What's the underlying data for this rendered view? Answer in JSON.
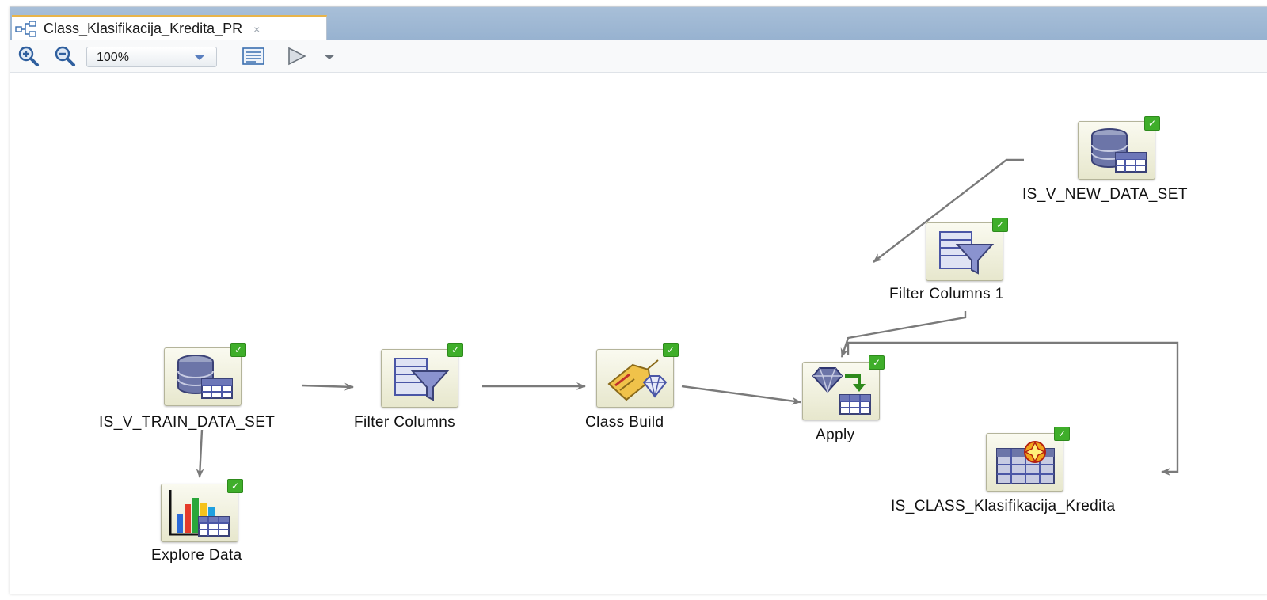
{
  "tab": {
    "title": "Class_Klasifikacija_Kredita_PR",
    "close": "×"
  },
  "toolbar": {
    "zoom_value": "100%"
  },
  "nodes": {
    "train": {
      "label": "IS_V_TRAIN_DATA_SET",
      "check": "✓"
    },
    "filter": {
      "label": "Filter Columns",
      "check": "✓"
    },
    "build": {
      "label": "Class Build",
      "check": "✓"
    },
    "apply": {
      "label": "Apply",
      "check": "✓"
    },
    "newdata": {
      "label": "IS_V_NEW_DATA_SET",
      "check": "✓"
    },
    "filter1": {
      "label": "Filter Columns 1",
      "check": "✓"
    },
    "classout": {
      "label": "IS_CLASS_Klasifikacija_Kredita",
      "check": "✓"
    },
    "explore": {
      "label": "Explore Data",
      "check": "✓"
    }
  },
  "colors": {
    "tab_strip": "#97b2d0",
    "node_fill": "#efefd9",
    "check_green": "#3fae2a",
    "link": "#7a7a7a"
  }
}
